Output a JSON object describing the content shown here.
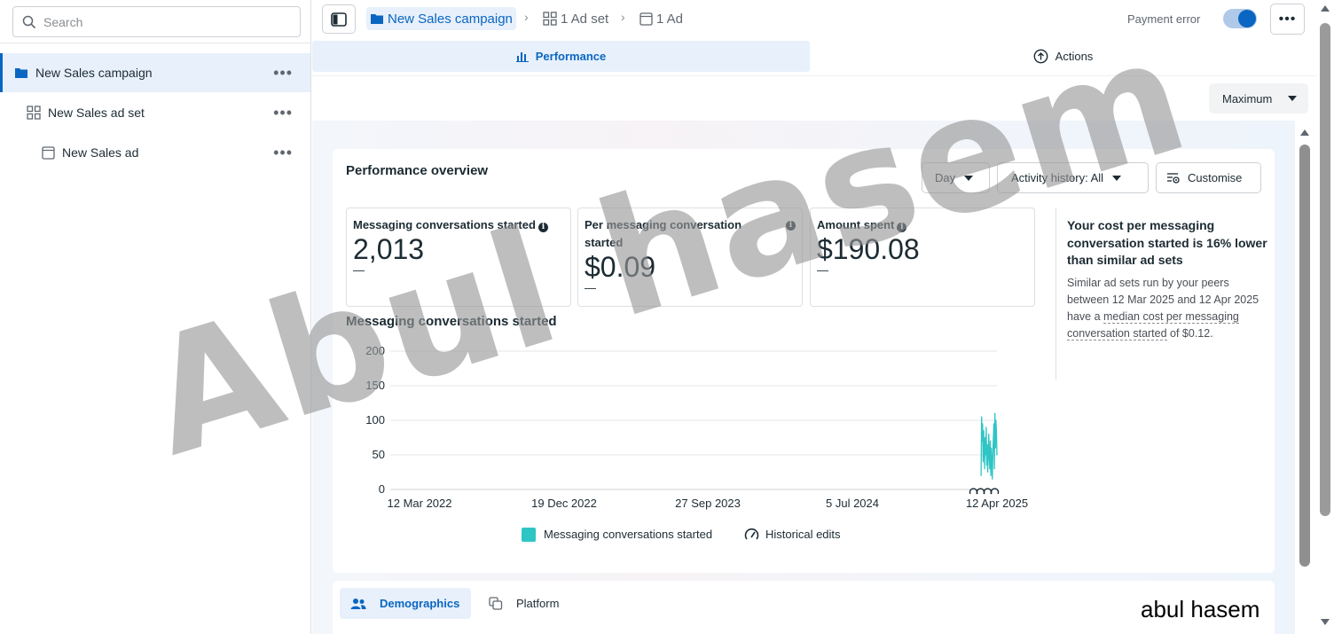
{
  "sidebar": {
    "search_placeholder": "Search",
    "items": [
      {
        "label": "New Sales campaign",
        "more": "•••"
      },
      {
        "label": "New Sales ad set",
        "more": "•••"
      },
      {
        "label": "New Sales ad",
        "more": "•••"
      }
    ]
  },
  "breadcrumb": [
    {
      "label": "New Sales campaign"
    },
    {
      "label": "1 Ad set"
    },
    {
      "label": "1 Ad"
    }
  ],
  "header": {
    "payment_status": "Payment error",
    "more_label": "•••",
    "toggle_on": true
  },
  "tabs": [
    {
      "label": "Performance",
      "active": true
    },
    {
      "label": "Actions",
      "active": false
    }
  ],
  "max_dropdown": "Maximum",
  "overview": {
    "title": "Performance overview",
    "controls": {
      "day": "Day",
      "activity": "Activity history: All",
      "customise": "Customise"
    },
    "metrics": [
      {
        "label": "Messaging conversations started",
        "value": "2,013",
        "delta": "—"
      },
      {
        "label": "Per messaging conversation started",
        "value": "$0.09",
        "delta": "—"
      },
      {
        "label": "Amount spent",
        "value": "$190.08",
        "delta": "—"
      }
    ],
    "insight": {
      "headline": "Your cost per messaging conversation started is 16% lower than similar ad sets",
      "body_prefix": "Similar ad sets run by your peers between 12 Mar 2025 and 12 Apr 2025 have a ",
      "body_link": "median cost per messaging conversation started",
      "body_suffix": " of $0.12."
    },
    "chart_title": "Messaging conversations started"
  },
  "chart_data": {
    "type": "line",
    "title": "Messaging conversations started",
    "x_tick_labels": [
      "12 Mar 2022",
      "19 Dec 2022",
      "27 Sep 2023",
      "5 Jul 2024",
      "12 Apr 2025"
    ],
    "y_ticks": [
      0,
      50,
      100,
      150,
      200
    ],
    "ylim": [
      0,
      200
    ],
    "series": [
      {
        "name": "Messaging conversations started",
        "color": "#2ec5c5",
        "x": [
          "2025-03-12",
          "2025-03-13",
          "2025-03-14",
          "2025-03-15",
          "2025-03-16",
          "2025-03-17",
          "2025-03-18",
          "2025-03-19",
          "2025-03-20",
          "2025-03-21",
          "2025-03-22",
          "2025-03-23",
          "2025-03-24",
          "2025-03-25",
          "2025-03-26",
          "2025-03-27",
          "2025-03-28",
          "2025-03-29",
          "2025-03-30",
          "2025-03-31",
          "2025-04-01",
          "2025-04-02",
          "2025-04-03",
          "2025-04-04",
          "2025-04-05",
          "2025-04-06",
          "2025-04-07",
          "2025-04-08",
          "2025-04-09",
          "2025-04-10",
          "2025-04-11",
          "2025-04-12"
        ],
        "y": [
          20,
          105,
          70,
          95,
          40,
          85,
          60,
          30,
          75,
          50,
          90,
          35,
          65,
          25,
          55,
          80,
          45,
          30,
          70,
          20,
          60,
          40,
          15,
          55,
          75,
          95,
          30,
          110,
          60,
          100,
          85,
          50
        ]
      }
    ],
    "legend": [
      "Messaging conversations started",
      "Historical edits"
    ],
    "legend_position": "bottom",
    "grid": true
  },
  "bottom_tabs": [
    {
      "label": "Demographics",
      "active": true
    },
    {
      "label": "Platform",
      "active": false
    }
  ],
  "watermark": "Abul hasem",
  "signature": "abul hasem"
}
